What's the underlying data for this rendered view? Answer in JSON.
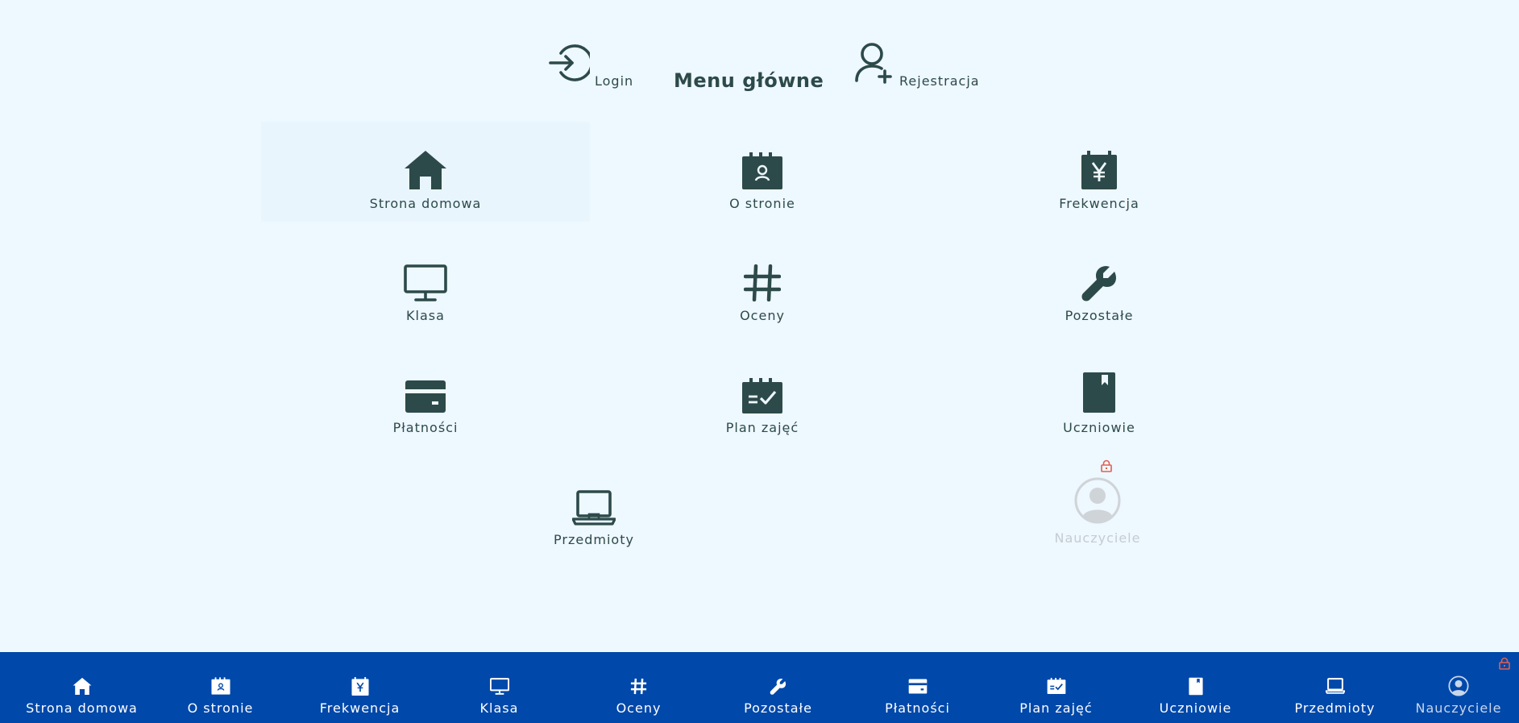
{
  "header": {
    "login_label": "Login",
    "title": "Menu główne",
    "register_label": "Rejestracja",
    "login_icon": "login-icon",
    "register_icon": "user-plus-icon"
  },
  "tiles": [
    {
      "label": "Strona domowa",
      "icon": "home-icon",
      "active": true
    },
    {
      "label": "O stronie",
      "icon": "calendar-badge-icon"
    },
    {
      "label": "Frekwencja",
      "icon": "calendar-yen-icon"
    },
    {
      "label": "Klasa",
      "icon": "monitor-icon"
    },
    {
      "label": "Oceny",
      "icon": "hash-icon"
    },
    {
      "label": "Pozostałe",
      "icon": "wrench-icon"
    },
    {
      "label": "Płatności",
      "icon": "credit-card-icon"
    },
    {
      "label": "Plan zajęć",
      "icon": "calendar-check-icon"
    },
    {
      "label": "Uczniowie",
      "icon": "book-icon"
    },
    {
      "label": "Przedmioty",
      "icon": "laptop-icon"
    },
    {
      "label": "Nauczyciele",
      "icon": "user-circle-icon",
      "locked": true
    }
  ],
  "bottom_nav": [
    {
      "label": "Strona domowa"
    },
    {
      "label": "O stronie"
    },
    {
      "label": "Frekwencja"
    },
    {
      "label": "Klasa"
    },
    {
      "label": "Oceny"
    },
    {
      "label": "Pozostałe"
    },
    {
      "label": "Płatności"
    },
    {
      "label": "Plan zajęć"
    },
    {
      "label": "Uczniowie"
    },
    {
      "label": "Przedmioty"
    },
    {
      "label": "Nauczyciele",
      "locked": true
    }
  ],
  "colors": {
    "background": "#eef8ff",
    "icon": "#2d4a4a",
    "nav_background": "#0048aa",
    "lock": "#e06050",
    "disabled": "#c5ccd2"
  }
}
